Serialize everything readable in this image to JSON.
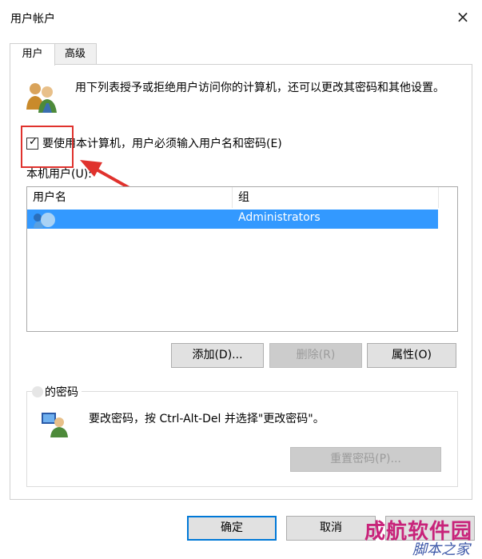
{
  "window": {
    "title": "用户帐户",
    "close_glyph": "×"
  },
  "tabs": [
    {
      "label": "用户"
    },
    {
      "label": "高级"
    }
  ],
  "description": "用下列表授予或拒绝用户访问你的计算机，还可以更改其密码和其他设置。",
  "checkbox": {
    "label": "要使用本计算机，用户必须输入用户名和密码(E)",
    "checked": true
  },
  "users_list": {
    "label": "本机用户(U):",
    "columns": [
      "用户名",
      "组"
    ],
    "rows": [
      {
        "name": "",
        "group": "Administrators",
        "selected": true
      }
    ]
  },
  "buttons": {
    "add": "添加(D)...",
    "delete": "删除(R)",
    "properties": "属性(O)"
  },
  "password_group": {
    "legend": "的密码",
    "text": "要改密码，按 Ctrl-Alt-Del 并选择\"更改密码\"。",
    "reset_button": "重置密码(P)..."
  },
  "footer": {
    "ok": "确定",
    "cancel": "取消",
    "apply": ""
  },
  "watermark": {
    "main": "成航软件园",
    "sub": "脚本之家"
  },
  "colors": {
    "selection": "#3399ff",
    "highlight_box": "#e0322d",
    "arrow": "#e0322d",
    "focus_border": "#0078d7"
  }
}
